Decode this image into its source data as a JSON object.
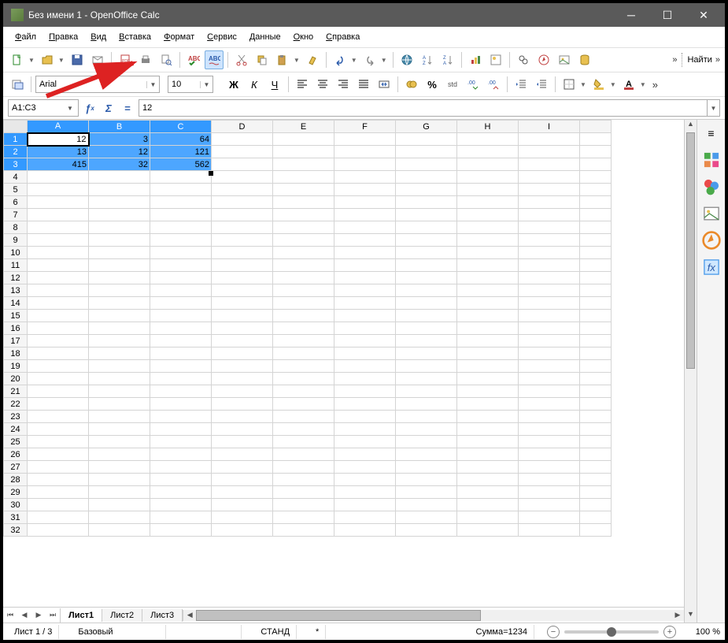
{
  "window": {
    "title": "Без имени 1 - OpenOffice Calc"
  },
  "menu": {
    "items": [
      "Файл",
      "Правка",
      "Вид",
      "Вставка",
      "Формат",
      "Сервис",
      "Данные",
      "Окно",
      "Справка"
    ]
  },
  "toolbar": {
    "find_label": "Найти"
  },
  "format": {
    "font_name": "Arial",
    "font_size": "10"
  },
  "formula": {
    "cell_ref": "A1:C3",
    "value": "12"
  },
  "columns": [
    "A",
    "B",
    "C",
    "D",
    "E",
    "F",
    "G",
    "H",
    "I"
  ],
  "row_count": 32,
  "selected_cols": [
    0,
    1,
    2
  ],
  "selected_rows": [
    1,
    2,
    3
  ],
  "cells": {
    "1": {
      "A": "12",
      "B": "3",
      "C": "64"
    },
    "2": {
      "A": "13",
      "B": "12",
      "C": "121"
    },
    "3": {
      "A": "415",
      "B": "32",
      "C": "562"
    }
  },
  "sheets": {
    "tabs": [
      "Лист1",
      "Лист2",
      "Лист3"
    ],
    "active": 0
  },
  "status": {
    "sheet_info": "Лист 1 / 3",
    "style": "Базовый",
    "mode": "СТАНД",
    "marker": "*",
    "sum": "Сумма=1234",
    "zoom": "100 %"
  }
}
